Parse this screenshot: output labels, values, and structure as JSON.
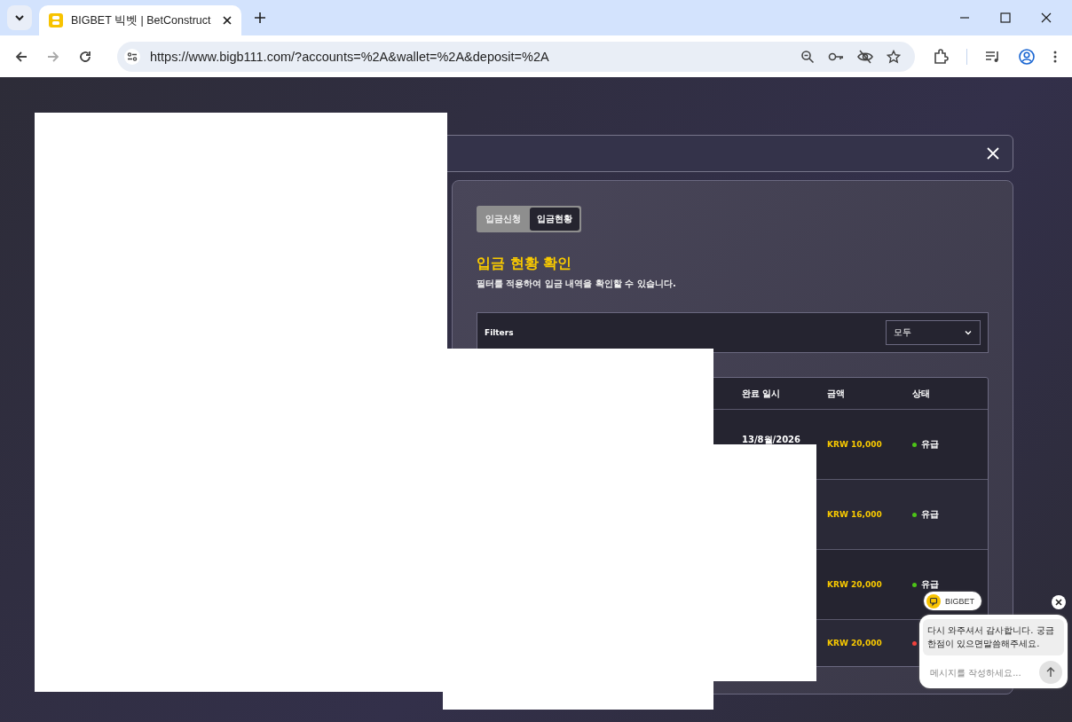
{
  "browser": {
    "tab_title": "BIGBET 빅벳 | BetConstruct",
    "url": "https://www.bigb111.com/?accounts=%2A&wallet=%2A&deposit=%2A"
  },
  "tabs": [
    {
      "label": "입금신청",
      "selected": false
    },
    {
      "label": "입금현황",
      "selected": true
    }
  ],
  "heading": "입금 현황 확인",
  "subheading": "필터를 적용하여 입금 내역을 확인할 수 있습니다.",
  "filters": {
    "label": "Filters",
    "value": "모두"
  },
  "table": {
    "columns": [
      "완료 일시",
      "금액",
      "상태"
    ],
    "rows": [
      {
        "date": "13/8월/2026",
        "amount": "KRW 10,000",
        "status": "유급",
        "color": "#4cc417"
      },
      {
        "amount": "KRW 16,000",
        "status": "유급",
        "color": "#4cc417"
      },
      {
        "amount": "KRW 20,000",
        "status": "유급",
        "color": "#4cc417"
      },
      {
        "amount": "KRW 20,000",
        "color": "#f0413b"
      }
    ]
  },
  "chat": {
    "brand": "BIGBET",
    "message": "다시 와주셔서 감사합니다. 궁금한점이 있으면말씀해주세요.",
    "placeholder": "메시지를 작성하세요..."
  }
}
